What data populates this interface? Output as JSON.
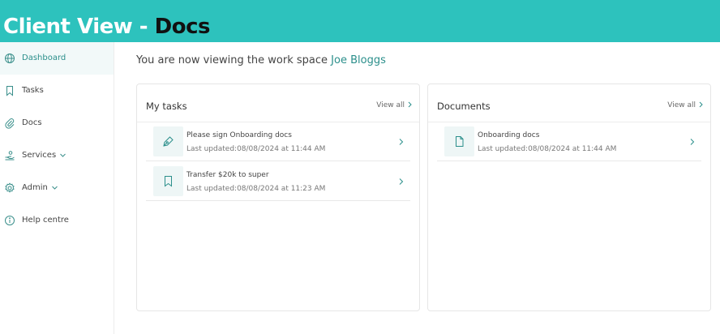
{
  "banner": {
    "title_part1": "Client View - ",
    "title_part2": "Docs"
  },
  "sidebar": {
    "items": [
      {
        "label": "Dashboard",
        "icon": "globe-icon",
        "active": true
      },
      {
        "label": "Tasks",
        "icon": "bookmark-icon"
      },
      {
        "label": "Docs",
        "icon": "paperclip-icon"
      },
      {
        "label": "Services",
        "icon": "hand-icon",
        "has_chevron": true
      },
      {
        "label": "Admin",
        "icon": "gear-icon",
        "has_chevron": true
      },
      {
        "label": "Help centre",
        "icon": "info-icon"
      }
    ]
  },
  "main": {
    "welcome_prefix": "You are now viewing the work space",
    "welcome_name": "Joe Bloggs"
  },
  "tasks_card": {
    "title": "My tasks",
    "view_all": "View all",
    "items": [
      {
        "title": "Please sign Onboarding docs",
        "subtitle": "Last updated:08/08/2024 at 11:44 AM",
        "icon": "pen-icon"
      },
      {
        "title": "Transfer $20k to super",
        "subtitle": "Last updated:08/08/2024 at 11:23 AM",
        "icon": "bookmark-icon"
      }
    ]
  },
  "documents_card": {
    "title": "Documents",
    "view_all": "View all",
    "items": [
      {
        "title": "Onboarding docs",
        "subtitle": "Last updated:08/08/2024 at 11:44 AM",
        "icon": "file-icon"
      }
    ]
  },
  "colors": {
    "banner": "#2dc2bd",
    "accent": "#2b8f8b",
    "tile": "#eef6f6"
  }
}
